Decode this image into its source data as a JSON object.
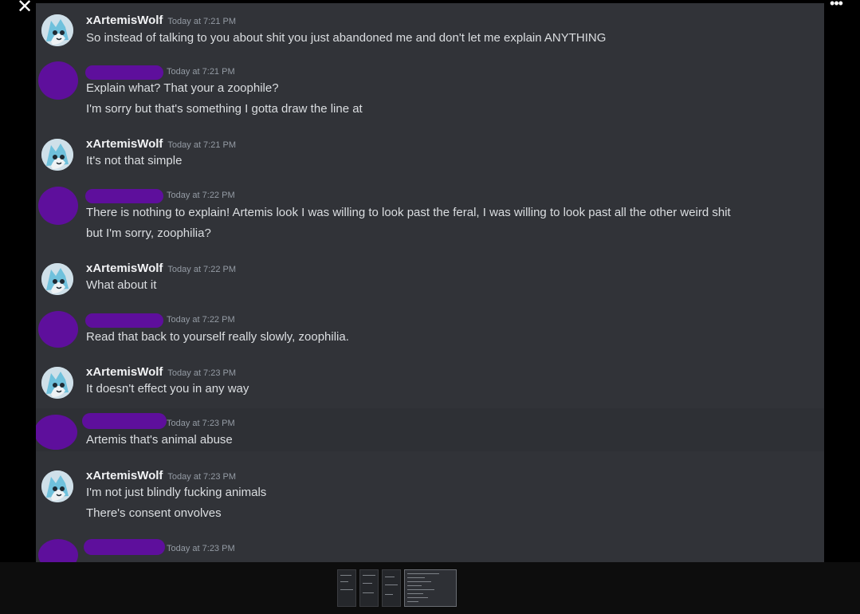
{
  "viewer": {
    "close_glyph": "✕",
    "more_glyph": "•••"
  },
  "colors": {
    "chat_bg": "#313338",
    "redaction": "#5e0f9c",
    "username": "#f2f3f5",
    "text": "#dbdee1",
    "timestamp": "#949ba4"
  },
  "messages": [
    {
      "author": "xArtemisWolf",
      "redacted": false,
      "avatar_icon": "wolf-avatar-icon",
      "timestamp": "Today at 7:21 PM",
      "lines": [
        "So instead of talking to you about shit you just abandoned me and don't let me explain ANYTHING"
      ]
    },
    {
      "author": "",
      "redacted": true,
      "timestamp": "Today at 7:21 PM",
      "lines": [
        "Explain what? That your a zoophile?",
        "I'm sorry but that's something I gotta draw the line at"
      ]
    },
    {
      "author": "xArtemisWolf",
      "redacted": false,
      "avatar_icon": "wolf-avatar-icon",
      "timestamp": "Today at 7:21 PM",
      "lines": [
        "It's not that simple"
      ]
    },
    {
      "author": "",
      "redacted": true,
      "timestamp": "Today at 7:22 PM",
      "lines": [
        "There is nothing to explain! Artemis look I was willing to look past the feral, I was willing to look past all the other weird shit",
        "but I'm sorry, zoophilia?"
      ]
    },
    {
      "author": "xArtemisWolf",
      "redacted": false,
      "avatar_icon": "wolf-avatar-icon",
      "timestamp": "Today at 7:22 PM",
      "lines": [
        "What about it"
      ]
    },
    {
      "author": "",
      "redacted": true,
      "timestamp": "Today at 7:22 PM",
      "lines": [
        "Read that back to yourself really slowly, zoophilia."
      ]
    },
    {
      "author": "xArtemisWolf",
      "redacted": false,
      "avatar_icon": "wolf-avatar-icon",
      "timestamp": "Today at 7:23 PM",
      "lines": [
        "It doesn't effect you in any way"
      ]
    },
    {
      "author": "",
      "redacted": true,
      "timestamp": "Today at 7:23 PM",
      "lines": [
        "Artemis that's animal abuse"
      ]
    },
    {
      "author": "xArtemisWolf",
      "redacted": false,
      "avatar_icon": "wolf-avatar-icon",
      "timestamp": "Today at 7:23 PM",
      "lines": [
        "I'm not just blindly fucking animals",
        "There's consent onvolves"
      ]
    },
    {
      "author": "",
      "redacted": true,
      "timestamp": "Today at 7:23 PM",
      "lines": []
    }
  ],
  "thumbnails": [
    {
      "label": "",
      "active": false
    },
    {
      "label": "",
      "active": false
    },
    {
      "label": "",
      "active": false
    },
    {
      "label": "",
      "active": true
    }
  ]
}
